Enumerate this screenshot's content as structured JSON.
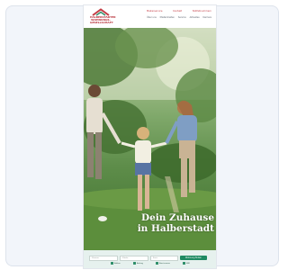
{
  "logo": {
    "text": "HALBERSTÄDTER\nWOHNUNGS-\nGESELLSCHAFT"
  },
  "header": {
    "top_links": [
      "Mieterservice",
      "Kontakt",
      "Notfallnummern"
    ],
    "nav": [
      "Über uns",
      "Mieteinheiten",
      "Service",
      "Aktuelles",
      "Karriere"
    ]
  },
  "hero": {
    "title_line1": "Dein Zuhause",
    "title_line2": "in Halberstadt"
  },
  "search": {
    "fields": [
      "Zimmer",
      "Fläche",
      "Preis"
    ],
    "button": "Wohnung finden",
    "checks": [
      "Balkon",
      "Aufzug",
      "Barrierearm",
      "EBK"
    ]
  },
  "colors": {
    "brand_red": "#c43c44",
    "brand_green": "#1f8a62",
    "bar_bg": "#e6f1ee"
  }
}
